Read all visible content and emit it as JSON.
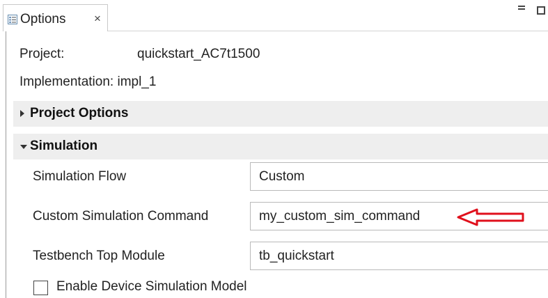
{
  "tab": {
    "title": "Options",
    "close_glyph": "×",
    "icon": "options-list-icon"
  },
  "window_controls": {
    "minimize": "minimize-icon",
    "maximize": "maximize-icon"
  },
  "info": {
    "project_label": "Project:",
    "project_value": "quickstart_AC7t1500",
    "implementation_label": "Implementation:",
    "implementation_value": "impl_1"
  },
  "sections": {
    "project_options": {
      "title": "Project Options",
      "expanded": false
    },
    "simulation": {
      "title": "Simulation",
      "expanded": true
    }
  },
  "simulation": {
    "flow_label": "Simulation Flow",
    "flow_value": "Custom",
    "command_label": "Custom Simulation Command",
    "command_value": "my_custom_sim_command",
    "testbench_label": "Testbench Top Module",
    "testbench_value": "tb_quickstart",
    "device_model_label": "Enable Device Simulation Model",
    "device_model_checked": false
  },
  "annotation": {
    "arrow_color": "#e0101c"
  }
}
